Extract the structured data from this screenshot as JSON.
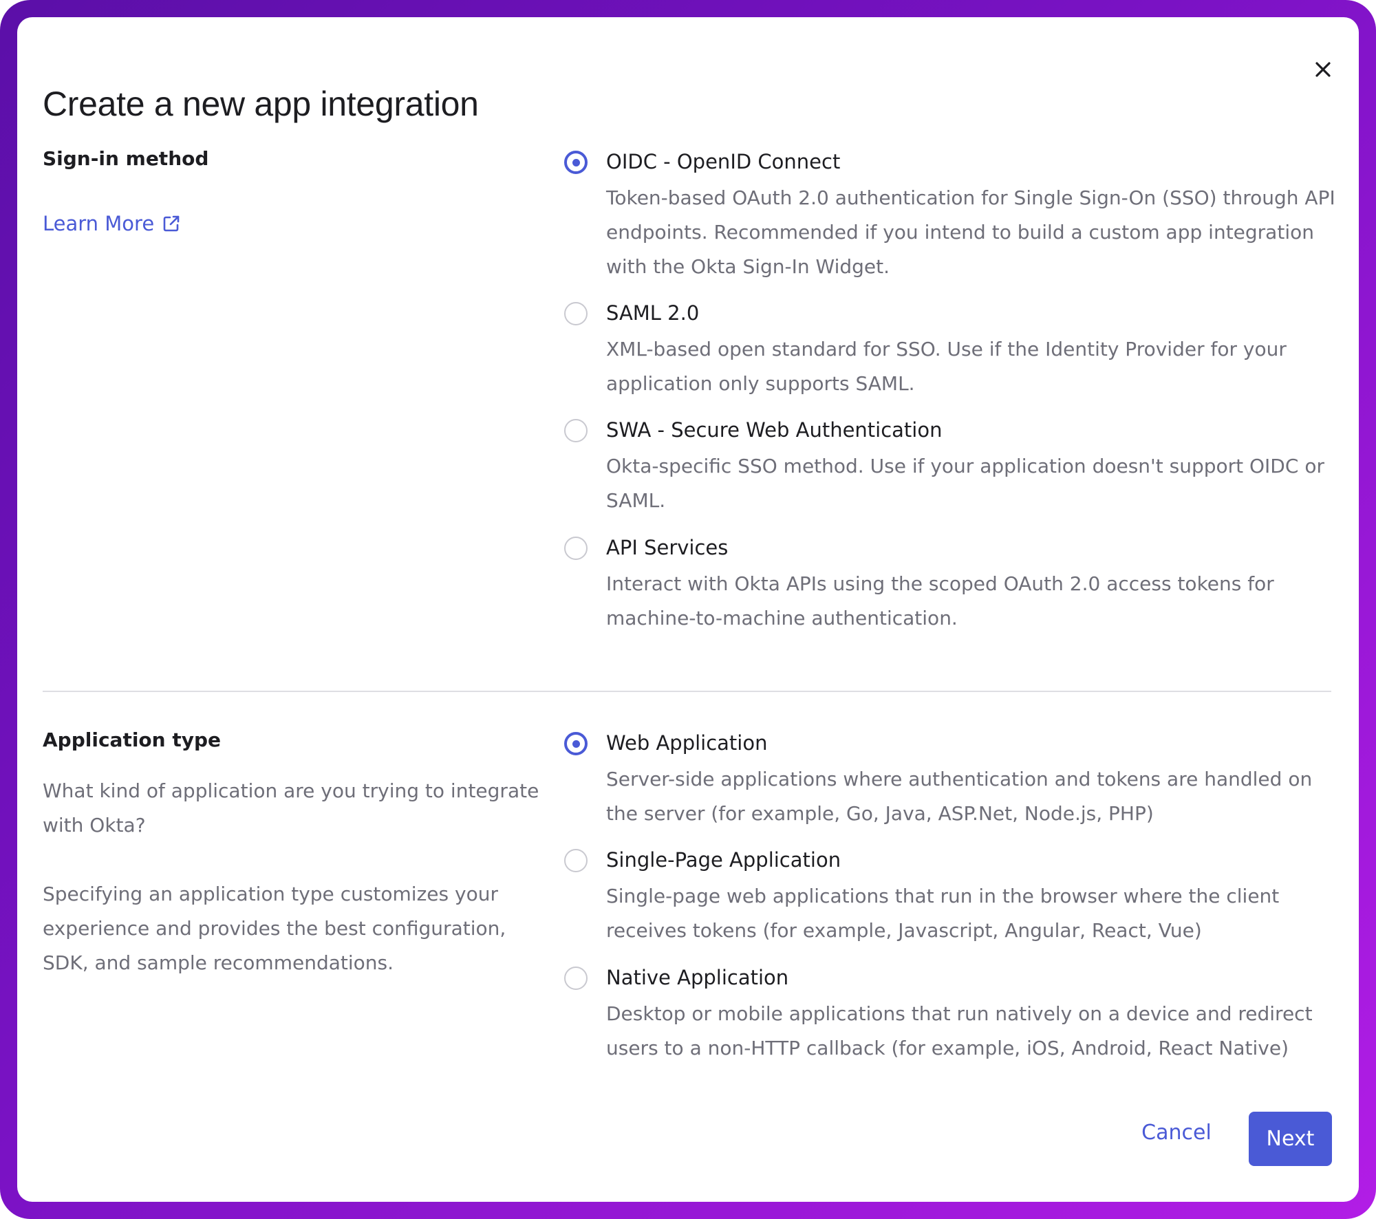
{
  "dialog": {
    "title": "Create a new app integration",
    "close_icon": "close-icon"
  },
  "sign_in": {
    "heading": "Sign-in method",
    "learn_more": "Learn More",
    "learn_more_icon": "external-link-icon",
    "options": [
      {
        "label": "OIDC - OpenID Connect",
        "description": "Token-based OAuth 2.0 authentication for Single Sign-On (SSO) through API endpoints. Recommended if you intend to build a custom app integration with the Okta Sign-In Widget.",
        "selected": true
      },
      {
        "label": "SAML 2.0",
        "description": "XML-based open standard for SSO. Use if the Identity Provider for your application only supports SAML.",
        "selected": false
      },
      {
        "label": "SWA - Secure Web Authentication",
        "description": "Okta-specific SSO method. Use if your application doesn't support OIDC or SAML.",
        "selected": false
      },
      {
        "label": "API Services",
        "description": "Interact with Okta APIs using the scoped OAuth 2.0 access tokens for machine-to-machine authentication.",
        "selected": false
      }
    ]
  },
  "app_type": {
    "heading": "Application type",
    "question": "What kind of application are you trying to integrate with Okta?",
    "explanation": "Specifying an application type customizes your experience and provides the best configuration, SDK, and sample recommendations.",
    "options": [
      {
        "label": "Web Application",
        "description": "Server-side applications where authentication and tokens are handled on the server (for example, Go, Java, ASP.Net, Node.js, PHP)",
        "selected": true
      },
      {
        "label": "Single-Page Application",
        "description": "Single-page web applications that run in the browser where the client receives tokens (for example, Javascript, Angular, React, Vue)",
        "selected": false
      },
      {
        "label": "Native Application",
        "description": "Desktop or mobile applications that run natively on a device and redirect users to a non-HTTP callback (for example, iOS, Android, React Native)",
        "selected": false
      }
    ]
  },
  "footer": {
    "cancel_label": "Cancel",
    "next_label": "Next"
  },
  "colors": {
    "accent": "#4a5ad6",
    "frame_start": "#5b0fa8",
    "frame_end": "#b21de6",
    "text_primary": "#1d1d21",
    "text_secondary": "#6e6e78"
  }
}
